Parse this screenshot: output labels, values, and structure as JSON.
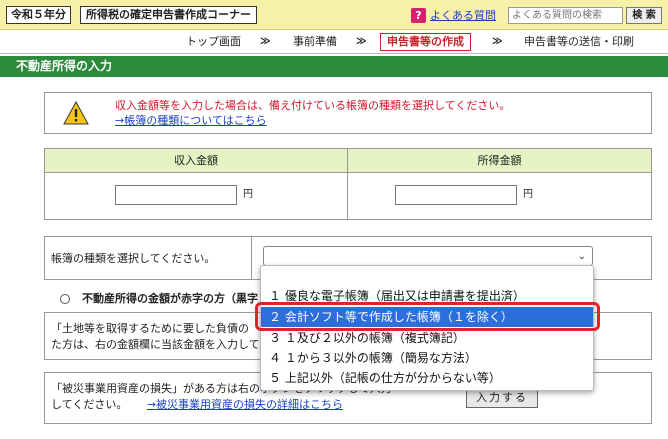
{
  "header": {
    "era": "令和５年分",
    "corner_title": "所得税の確定申告書作成コーナー",
    "help_icon": "?",
    "faq_link": "よくある質問",
    "search_placeholder": "よくある質問の検索",
    "search_button": "検 索"
  },
  "steps": {
    "items": [
      "トップ画面",
      "事前準備",
      "申告書等の作成",
      "申告書等の送信・印刷"
    ],
    "separator": "≫",
    "current": "申告書等の作成"
  },
  "section": {
    "title": "不動産所得の入力"
  },
  "warning": {
    "icon": "warning-triangle-icon",
    "text": "収入金額等を入力した場合は、備え付けている帳簿の種類を選択してください。",
    "link": "→帳簿の種類についてはこちら"
  },
  "amounts": {
    "income_header": "収入金額",
    "earnings_header": "所得金額",
    "income_value": "",
    "earnings_value": "",
    "unit": "円"
  },
  "ledger": {
    "label": "帳簿の種類を選択してください。",
    "selected_value": ""
  },
  "deficit": {
    "label": "不動産所得の金額が赤字の方（黒字"
  },
  "land_box": {
    "line1": "「土地等を取得するために要した負債の",
    "line2": "た方は、右の金額欄に当該金額を入力して"
  },
  "loss_box": {
    "line1": "「被災事業用資産の損失」がある方は右のボタンをクリックして入力",
    "line2": "してください。",
    "link": "→被災事業用資産の損失の詳細はこちら",
    "button": "入力する"
  },
  "dropdown": {
    "options": [
      "１ 優良な電子帳簿（届出又は申請書を提出済）",
      "２ 会計ソフト等で作成した帳簿（１を除く）",
      "３ １及び２以外の帳簿（複式簿記）",
      "４ １から３以外の帳簿（簡易な方法）",
      "５ 上記以外（記帳の仕方が分からない等）"
    ],
    "selected_index": 1
  },
  "colors": {
    "section_green": "#2c8a3c",
    "header_yellow": "#f6f0a8",
    "warning_red": "#d3172a",
    "link_blue": "#1a3fc4",
    "selected_blue": "#2d6ddc",
    "highlight_red": "#e0232b"
  }
}
